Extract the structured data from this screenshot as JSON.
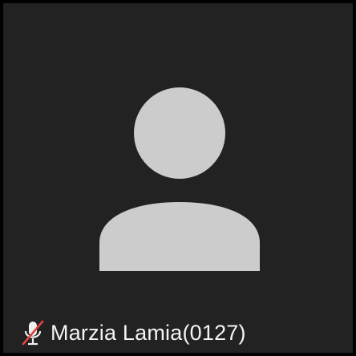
{
  "participant": {
    "name": "Marzia Lamia(0127)",
    "muted": true,
    "mic_icon": "mic-muted-icon",
    "avatar_icon": "person-placeholder-icon"
  },
  "colors": {
    "tile_border": "#000000",
    "tile_background": "#222222",
    "avatar": "#cccccc",
    "name_text": "#f4f4f4",
    "mute_slash": "#e0443a",
    "mic_body": "#f0f0f0"
  }
}
